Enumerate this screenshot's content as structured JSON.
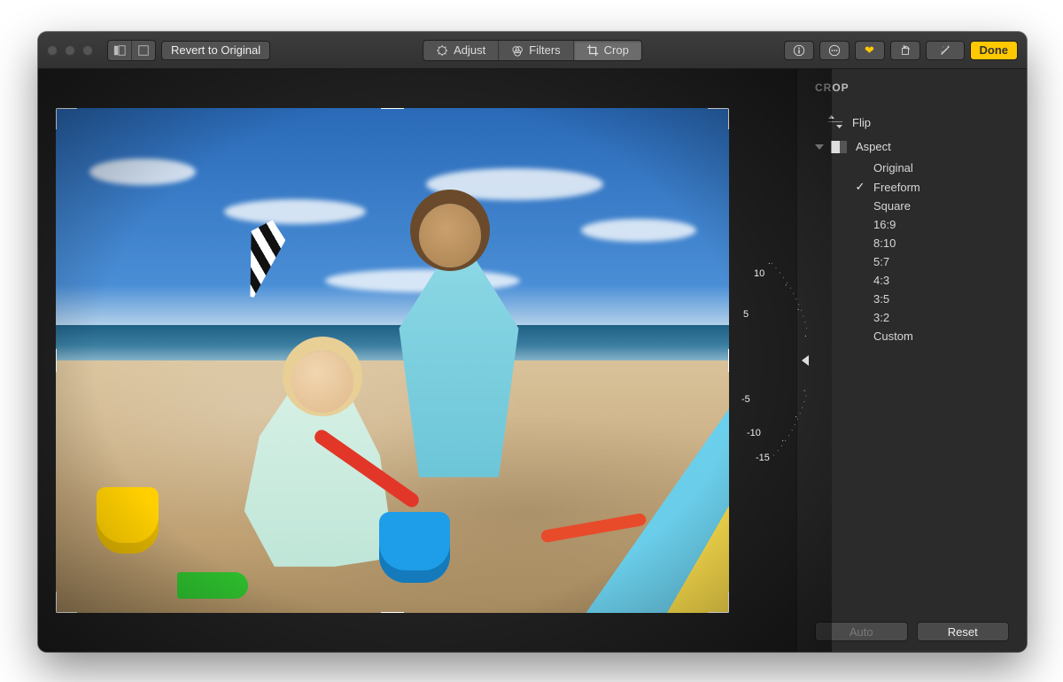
{
  "toolbar": {
    "revert_label": "Revert to Original",
    "tabs": {
      "adjust": "Adjust",
      "filters": "Filters",
      "crop": "Crop",
      "active": "crop"
    },
    "done_label": "Done"
  },
  "sidebar": {
    "title": "CROP",
    "flip_label": "Flip",
    "aspect_label": "Aspect",
    "aspect_expanded": true,
    "aspect_selected_index": 1,
    "aspect_options": [
      "Original",
      "Freeform",
      "Square",
      "16:9",
      "8:10",
      "5:7",
      "4:3",
      "3:5",
      "3:2",
      "Custom"
    ],
    "auto_label": "Auto",
    "reset_label": "Reset",
    "auto_enabled": false
  },
  "dial": {
    "ticks": [
      "10",
      "5",
      "-5",
      "-10",
      "-15"
    ]
  },
  "colors": {
    "accent": "#ffc800",
    "window_bg": "#2b2b2b"
  }
}
